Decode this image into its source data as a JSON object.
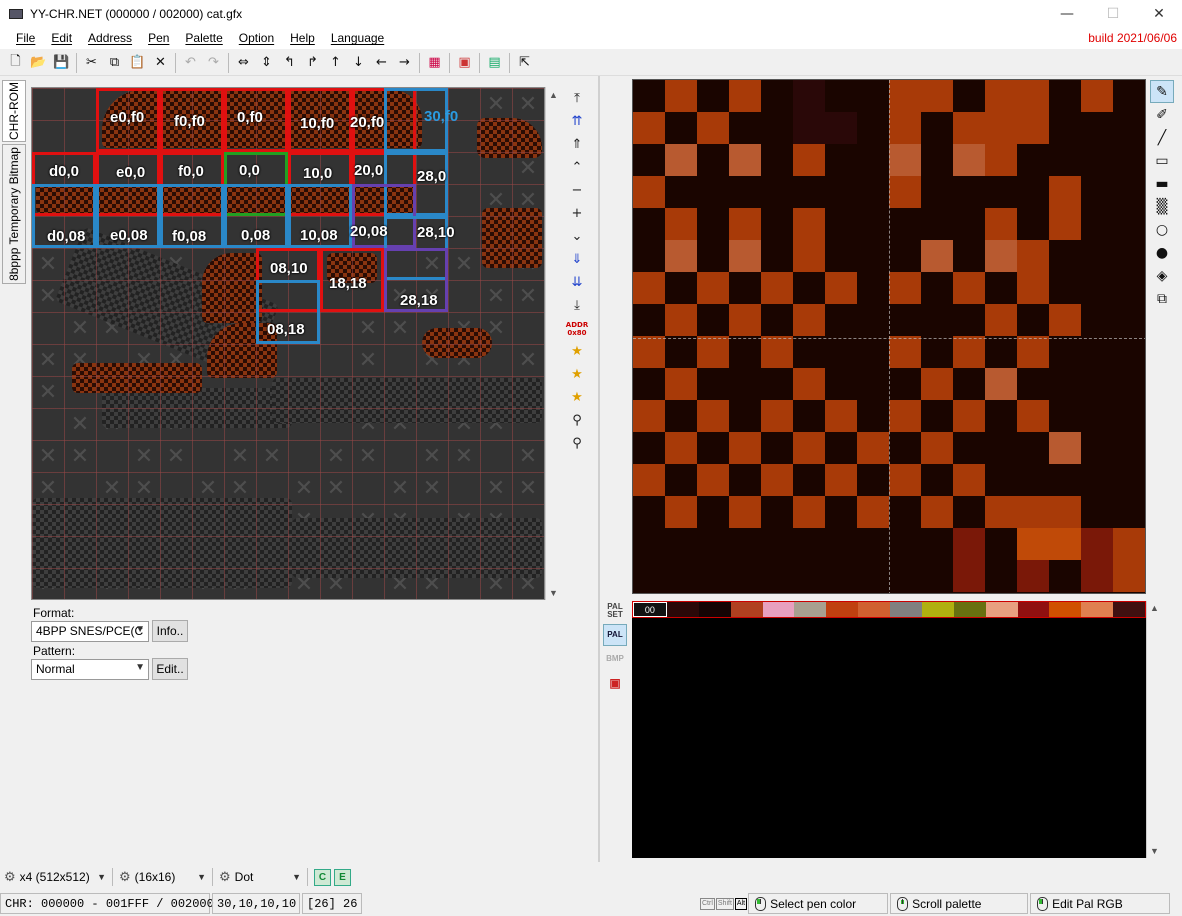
{
  "window": {
    "title": "YY-CHR.NET (000000 / 002000) cat.gfx",
    "minimize_glyph": "—",
    "maximize_glyph": "☐",
    "close_glyph": "✕"
  },
  "menu": {
    "items": [
      "File",
      "Edit",
      "Address",
      "Pen",
      "Palette",
      "Option",
      "Help",
      "Language"
    ],
    "build": "build 2021/06/06"
  },
  "toolbar": {
    "icons": [
      "new-icon",
      "open-icon",
      "save-icon",
      "cut-icon",
      "copy-icon",
      "paste-icon",
      "delete-icon",
      "undo-icon",
      "redo-icon",
      "flip-horizontal-icon",
      "flip-vertical-icon",
      "rotate-left-icon",
      "rotate-right-icon",
      "shift-up-icon",
      "shift-down-icon",
      "shift-left-icon",
      "shift-right-icon",
      "replace-color-icon",
      "palette-icon",
      "save-bitmap-icon",
      "external-icon"
    ]
  },
  "side_tabs": [
    "CHR-ROM",
    "8bppp Temporary Bitmap"
  ],
  "chr_view": {
    "labels": [
      {
        "text": "e0,f0",
        "style": "white"
      },
      {
        "text": "f0,f0",
        "style": "white"
      },
      {
        "text": "0,f0",
        "style": "white"
      },
      {
        "text": "10,f0",
        "style": "white"
      },
      {
        "text": "20,f0",
        "style": "white"
      },
      {
        "text": "30,f0",
        "style": "blue"
      },
      {
        "text": "d0,0",
        "style": "white"
      },
      {
        "text": "e0,0",
        "style": "white"
      },
      {
        "text": "f0,0",
        "style": "white"
      },
      {
        "text": "0,0",
        "style": "white"
      },
      {
        "text": "10,0",
        "style": "white"
      },
      {
        "text": "20,0",
        "style": "white"
      },
      {
        "text": "28,0",
        "style": "white"
      },
      {
        "text": "d0,08",
        "style": "white"
      },
      {
        "text": "e0,08",
        "style": "white"
      },
      {
        "text": "f0,08",
        "style": "white"
      },
      {
        "text": "0,08",
        "style": "white"
      },
      {
        "text": "10,08",
        "style": "white"
      },
      {
        "text": "20,08",
        "style": "white"
      },
      {
        "text": "28,10",
        "style": "white"
      },
      {
        "text": "08,10",
        "style": "white"
      },
      {
        "text": "18,18",
        "style": "white"
      },
      {
        "text": "28,18",
        "style": "white"
      },
      {
        "text": "08,18",
        "style": "white"
      }
    ]
  },
  "nav_buttons": [
    "⤒",
    "⇈",
    "⇑",
    "⌃",
    "−",
    "+",
    "⌄",
    "⇓",
    "⇊",
    "⤓"
  ],
  "addr_button": "ADDR 0x80",
  "format": {
    "label": "Format:",
    "value": "4BPP SNES/PCE(C",
    "info_button": "Info..",
    "pattern_label": "Pattern:",
    "pattern_value": "Normal",
    "edit_button": "Edit.."
  },
  "zoom_view": {
    "palette": [
      "#1a0500",
      "#a83a08",
      "#b85a30",
      "#2a0808",
      "#7a1808",
      "#c04a08",
      "#120200"
    ],
    "grid_rows": [
      "0101030011011010",
      "1010033010111000",
      "0202010020210000",
      "1000000010000100",
      "0101010000010100",
      "0202010002021000",
      "1010101010101000",
      "0101010000010100",
      "1010100010101000",
      "0100010001020000",
      "1010101010101000",
      "0101010101000200",
      "1010101010100000",
      "0101010101011100",
      "0000000000405541",
      "0000000000404041"
    ]
  },
  "draw_tools": [
    "pencil-icon",
    "brush-icon",
    "line-icon",
    "rectangle-icon",
    "filled-rectangle-icon",
    "pattern-fill-icon",
    "circle-icon",
    "filled-circle-icon",
    "bucket-fill-icon",
    "copy-tool-icon"
  ],
  "pal_side": {
    "palset": "PAL SET",
    "pal": "PAL",
    "bmp": "BMP"
  },
  "palette_strip": {
    "selected": "00",
    "colors": [
      "#000000",
      "#2a0808",
      "#140404",
      "#b04020",
      "#e8a0c0",
      "#a8a090",
      "#c04010",
      "#d06030",
      "#808080",
      "#b0b010",
      "#687010",
      "#e8a080",
      "#901010",
      "#d05000",
      "#e08050",
      "#401010"
    ]
  },
  "bottom": {
    "zoom": "x4 (512x512)",
    "grid": "(16x16)",
    "mode": "Dot",
    "toggle1": "C",
    "toggle2": "E"
  },
  "status": {
    "chr": "CHR: 000000 - 001FFF / 002000",
    "coords": "30,10,10,10",
    "index": "[26] 26",
    "keys": [
      "Ctrl",
      "Shift",
      "Alt"
    ],
    "hint1": "Select pen color",
    "hint2": "Scroll palette",
    "hint3": "Edit Pal RGB"
  }
}
